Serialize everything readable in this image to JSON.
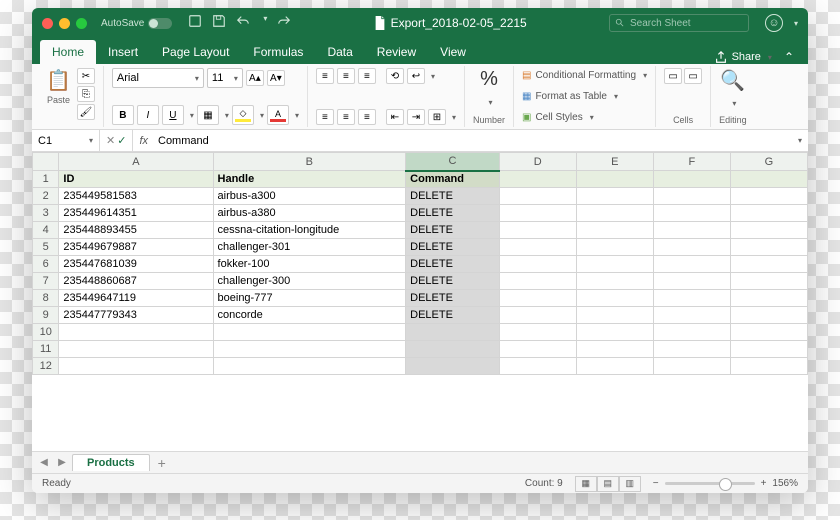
{
  "title": "Export_2018-02-05_2215",
  "autosave": "AutoSave",
  "search_placeholder": "Search Sheet",
  "tabs": {
    "home": "Home",
    "insert": "Insert",
    "page_layout": "Page Layout",
    "formulas": "Formulas",
    "data": "Data",
    "review": "Review",
    "view": "View"
  },
  "share": "Share",
  "ribbon": {
    "paste": "Paste",
    "font_name": "Arial",
    "font_size": "11",
    "bold": "B",
    "italic": "I",
    "underline": "U",
    "number": "Number",
    "cond_fmt": "Conditional Formatting",
    "fmt_table": "Format as Table",
    "cell_styles": "Cell Styles",
    "cells": "Cells",
    "editing": "Editing"
  },
  "namebox": {
    "cell": "C1",
    "formula": "Command"
  },
  "columns": [
    "A",
    "B",
    "C",
    "D",
    "E",
    "F",
    "G"
  ],
  "header_row": {
    "A": "ID",
    "B": "Handle",
    "C": "Command"
  },
  "rows": [
    {
      "n": 2,
      "A": "235449581583",
      "B": "airbus-a300",
      "C": "DELETE"
    },
    {
      "n": 3,
      "A": "235449614351",
      "B": "airbus-a380",
      "C": "DELETE"
    },
    {
      "n": 4,
      "A": "235448893455",
      "B": "cessna-citation-longitude",
      "C": "DELETE"
    },
    {
      "n": 5,
      "A": "235449679887",
      "B": "challenger-301",
      "C": "DELETE"
    },
    {
      "n": 6,
      "A": "235447681039",
      "B": "fokker-100",
      "C": "DELETE"
    },
    {
      "n": 7,
      "A": "235448860687",
      "B": "challenger-300",
      "C": "DELETE"
    },
    {
      "n": 8,
      "A": "235449647119",
      "B": "boeing-777",
      "C": "DELETE"
    },
    {
      "n": 9,
      "A": "235447779343",
      "B": "concorde",
      "C": "DELETE"
    }
  ],
  "empty_rows": [
    10,
    11,
    12
  ],
  "sheet_tab": "Products",
  "status": {
    "ready": "Ready",
    "count": "Count: 9",
    "zoom": "156%"
  }
}
